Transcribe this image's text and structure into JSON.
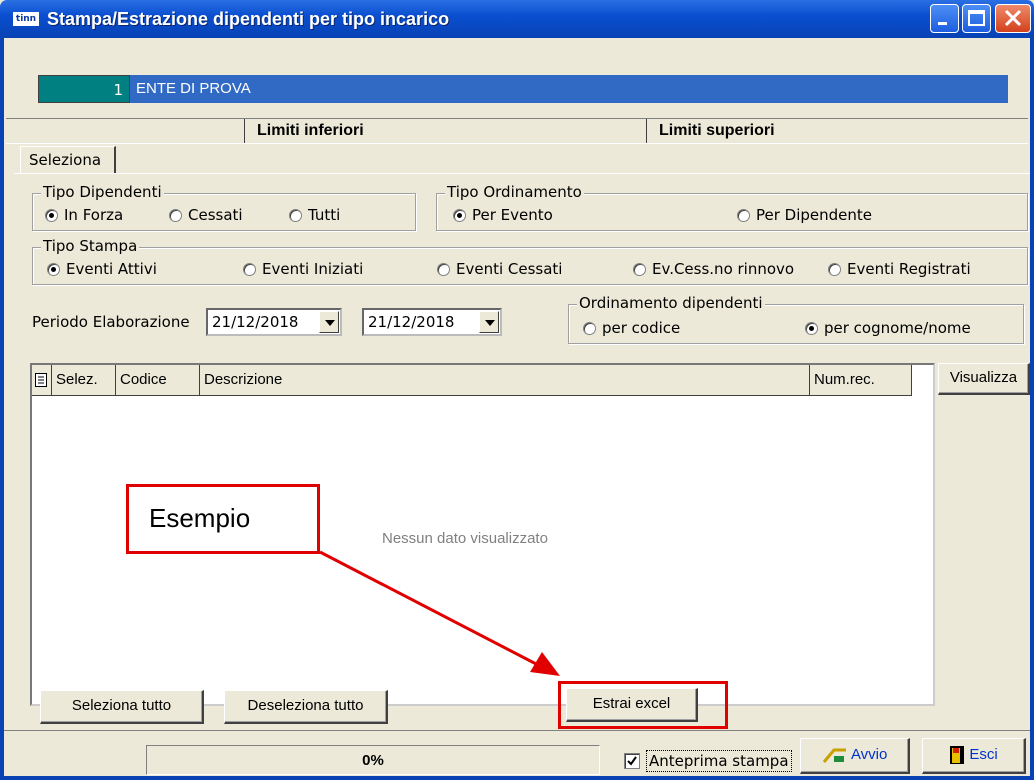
{
  "window": {
    "icon_text": "tinn",
    "title": "Stampa/Estrazione dipendenti per tipo incarico"
  },
  "ente": {
    "code": "1",
    "name": "ENTE DI PROVA"
  },
  "limits": {
    "lower": "Limiti inferiori",
    "upper": "Limiti superiori"
  },
  "tab": {
    "label": "Seleziona"
  },
  "tipo_dipendenti": {
    "title": "Tipo Dipendenti",
    "options": [
      "In Forza",
      "Cessati",
      "Tutti"
    ],
    "selected": "In Forza"
  },
  "tipo_ordinamento": {
    "title": "Tipo Ordinamento",
    "options": [
      "Per Evento",
      "Per Dipendente"
    ],
    "selected": "Per Evento"
  },
  "tipo_stampa": {
    "title": "Tipo Stampa",
    "options": [
      "Eventi Attivi",
      "Eventi Iniziati",
      "Eventi Cessati",
      "Ev.Cess.no rinnovo",
      "Eventi Registrati"
    ],
    "selected": "Eventi Attivi"
  },
  "periodo": {
    "label": "Periodo Elaborazione",
    "from": "21/12/2018",
    "to": "21/12/2018"
  },
  "ordinamento_dipendenti": {
    "title": "Ordinamento dipendenti",
    "options": [
      "per codice",
      "per cognome/nome"
    ],
    "selected": "per cognome/nome"
  },
  "grid": {
    "columns": [
      "Selez.",
      "Codice",
      "Descrizione",
      "Num.rec."
    ],
    "empty_text": "Nessun dato visualizzato"
  },
  "buttons": {
    "visualizza": "Visualizza",
    "seleziona_tutto": "Seleziona tutto",
    "deseleziona_tutto": "Deseleziona tutto",
    "estrai_excel": "Estrai excel",
    "avvio": "Avvio",
    "esci": "Esci"
  },
  "annotation": {
    "callout": "Esempio",
    "color": "#e00000"
  },
  "status": {
    "progress": "0%",
    "anteprima_label": "Anteprima stampa",
    "anteprima_checked": true
  }
}
